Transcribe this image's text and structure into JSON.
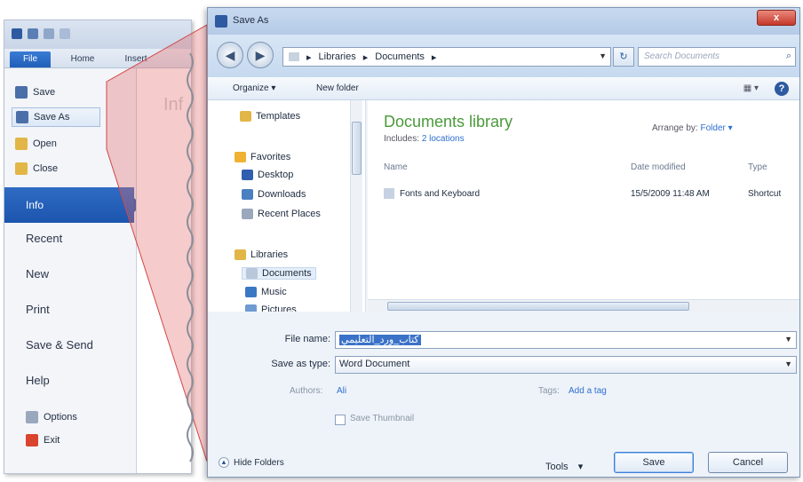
{
  "backstage": {
    "tabs": [
      "File",
      "Home",
      "Insert"
    ],
    "menu": [
      "Save",
      "Save As",
      "Open",
      "Close"
    ],
    "info": "Info",
    "info_ghost": "Inf",
    "nav": [
      "Recent",
      "New",
      "Print",
      "Save & Send",
      "Help"
    ],
    "options": "Options",
    "exit": "Exit"
  },
  "dialog": {
    "title": "Save As",
    "close": "x",
    "breadcrumb": [
      "Libraries",
      "Documents"
    ],
    "search_placeholder": "Search Documents",
    "toolbar": {
      "organize": "Organize ▾",
      "new_folder": "New folder"
    },
    "nav_pane": {
      "templates": "Templates",
      "favorites": "Favorites",
      "desktop": "Desktop",
      "downloads": "Downloads",
      "recent_places": "Recent Places",
      "libraries": "Libraries",
      "documents": "Documents",
      "music": "Music",
      "pictures": "Pictures"
    },
    "library": {
      "title": "Documents library",
      "includes_label": "Includes:",
      "includes_link": "2 locations",
      "arrange_label": "Arrange by:",
      "arrange_value": "Folder ▾"
    },
    "columns": {
      "name": "Name",
      "date": "Date modified",
      "type": "Type"
    },
    "rows": [
      {
        "name": "Fonts and Keyboard",
        "date": "15/5/2009 11:48 AM",
        "type": "Shortcut"
      }
    ],
    "form": {
      "file_name_label": "File name:",
      "file_name_value": "كتاب_ورد_التعليمي",
      "save_type_label": "Save as type:",
      "save_type_value": "Word Document",
      "authors_label": "Authors:",
      "authors_value": "Ali",
      "tags_label": "Tags:",
      "tags_value": "Add a tag",
      "thumbnail_label": "Save Thumbnail"
    },
    "footer": {
      "hide_folders": "Hide Folders",
      "tools": "Tools",
      "save": "Save",
      "cancel": "Cancel"
    }
  },
  "colors": {
    "accent": "#2f6bc4",
    "library_title": "#4a9a3a",
    "link": "#2d6fd0",
    "zoom_funnel": "#e36a6a"
  }
}
